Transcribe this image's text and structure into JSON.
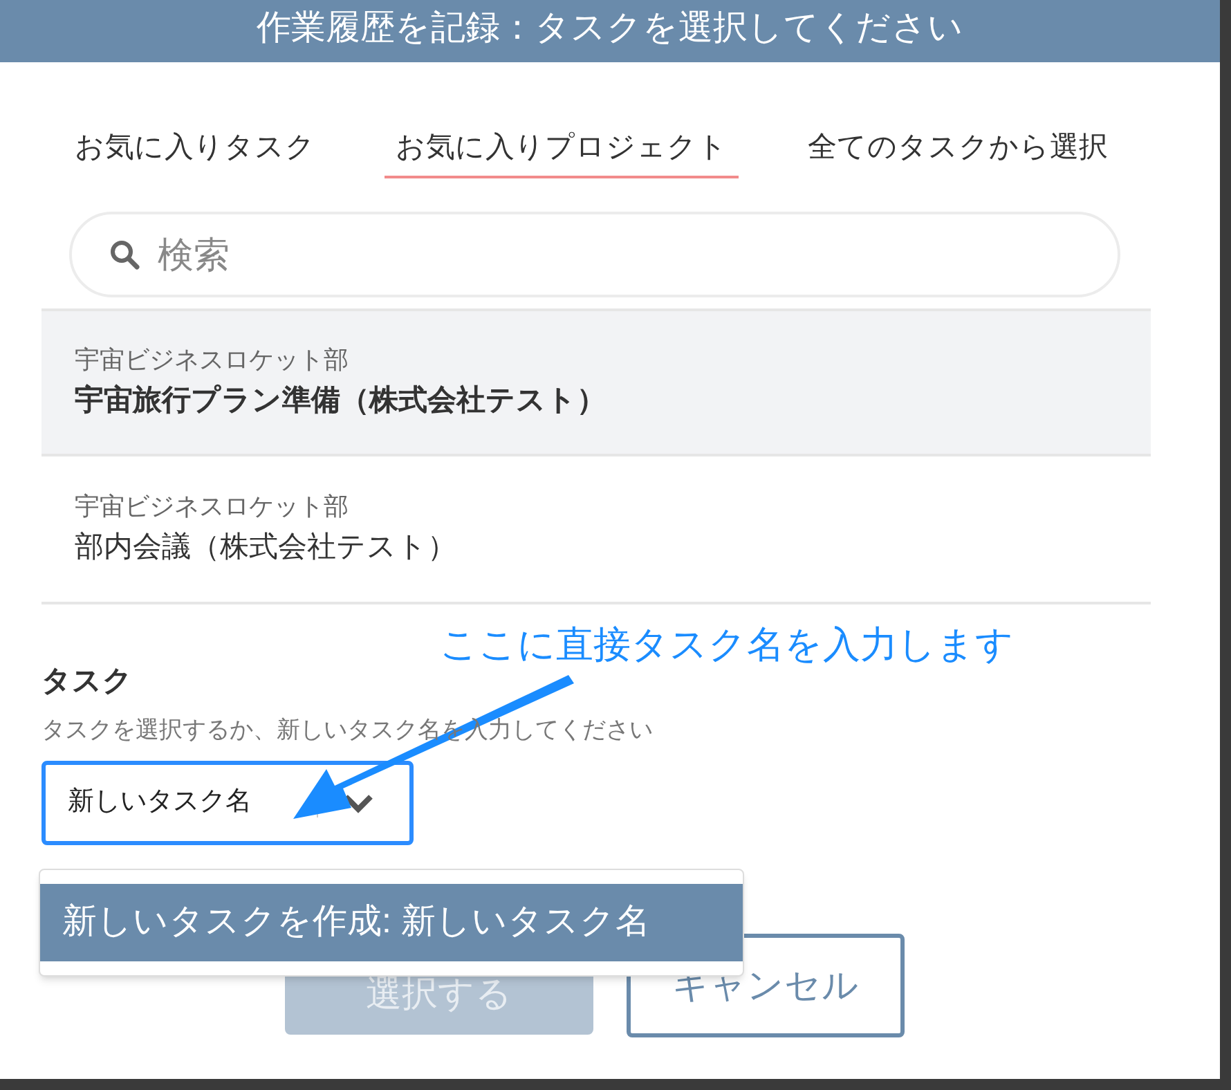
{
  "dialog": {
    "title": "作業履歴を記録：タスクを選択してください"
  },
  "tabs": [
    {
      "label": "お気に入りタスク",
      "selected": false
    },
    {
      "label": "お気に入りプロジェクト",
      "selected": true
    },
    {
      "label": "全てのタスクから選択",
      "selected": false
    }
  ],
  "search": {
    "placeholder": "検索"
  },
  "projects": [
    {
      "group": "宇宙ビジネスロケット部",
      "name": "宇宙旅行プラン準備（株式会社テスト）",
      "selected": true
    },
    {
      "group": "宇宙ビジネスロケット部",
      "name": "部内会議（株式会社テスト）",
      "selected": false
    }
  ],
  "annotation": "ここに直接タスク名を入力します",
  "task_field": {
    "label": "タスク",
    "hint": "タスクを選択するか、新しいタスク名を入力してください",
    "value": "新しいタスク名"
  },
  "dropdown_options": [
    {
      "label": "新しいタスクを作成: 新しいタスク名",
      "selected": true
    }
  ],
  "buttons": [
    {
      "label": "選択する",
      "kind": "primary",
      "disabled": true
    },
    {
      "label": "キャンセル",
      "kind": "secondary",
      "disabled": false
    }
  ]
}
